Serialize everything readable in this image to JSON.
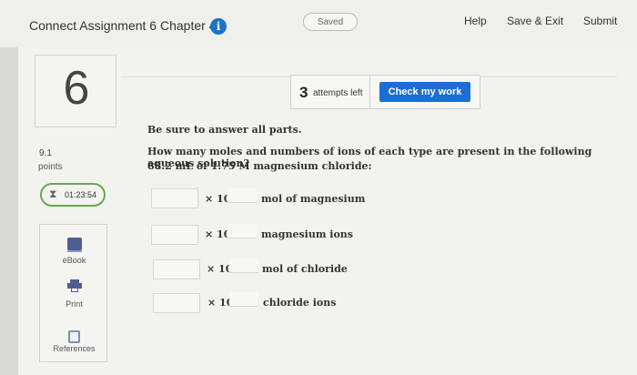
{
  "header": {
    "title": "Connect Assignment 6 Chapter 4",
    "info_icon": "info-icon",
    "saved": "Saved",
    "help": "Help",
    "save_exit": "Save & Exit",
    "submit": "Submit"
  },
  "question": {
    "number": "6",
    "points_value": "9.1",
    "points_label": "points",
    "timer": "01:23:54",
    "attempts_count": "3",
    "attempts_label": "attempts left",
    "check_label": "Check my work",
    "instruction": "Be sure to answer all parts.",
    "prompt_line1": "How many moles and numbers of ions of each type are present in the following aqueous solution?",
    "prompt_line2": "88.2 mL of 1.75 M magnesium chloride:"
  },
  "tools": [
    {
      "label": "eBook",
      "icon": "ebook-icon"
    },
    {
      "label": "Print",
      "icon": "printer-icon"
    },
    {
      "label": "References",
      "icon": "references-icon"
    }
  ],
  "answers": [
    {
      "times": "× 10",
      "unit": "mol of magnesium"
    },
    {
      "times": "× 10",
      "unit": "magnesium ions"
    },
    {
      "times": "× 10",
      "unit": "mol of chloride"
    },
    {
      "times": "× 10",
      "unit": "chloride ions"
    }
  ],
  "colors": {
    "accent": "#1b6fd1",
    "timer_border": "#6aa84f",
    "tool_icon": "#4f5e91"
  }
}
